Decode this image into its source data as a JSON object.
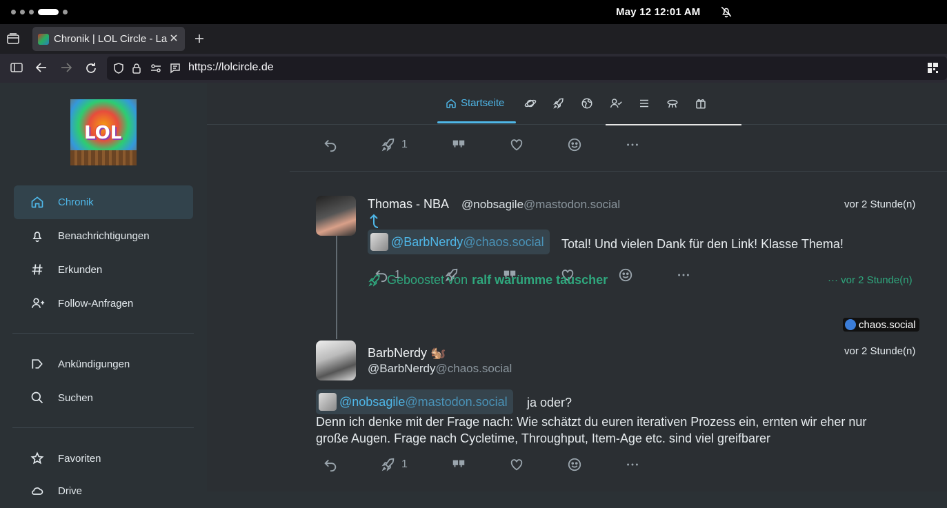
{
  "os": {
    "clock": "May 12  12:01 AM"
  },
  "browser": {
    "tab_title": "Chronik | LOL Circle - La",
    "url": "https://lolcircle.de"
  },
  "sidebar": {
    "logo_text": "LOL",
    "items": [
      {
        "label": "Chronik",
        "icon": "home-icon",
        "active": true
      },
      {
        "label": "Benachrichtigungen",
        "icon": "bell-icon"
      },
      {
        "label": "Erkunden",
        "icon": "hash-icon"
      },
      {
        "label": "Follow-Anfragen",
        "icon": "user-plus-icon"
      },
      {
        "label": "Ankündigungen",
        "icon": "megaphone-icon"
      },
      {
        "label": "Suchen",
        "icon": "search-icon"
      },
      {
        "label": "Favoriten",
        "icon": "star-icon"
      },
      {
        "label": "Drive",
        "icon": "cloud-icon"
      }
    ]
  },
  "topnav": {
    "home_label": "Startseite",
    "icons": [
      "planet-icon",
      "rocket-icon",
      "globe-icon",
      "user-check-icon",
      "list-icon",
      "antenna-icon",
      "gift-icon"
    ]
  },
  "timeline": {
    "first_actions": {
      "boost_count": "1"
    },
    "post1": {
      "name": "Thomas - NBA",
      "handle": "@nobsagile",
      "handle_domain": "@mastodon.social",
      "time": "vor 2 Stunde(n)",
      "mention_user": "@BarbNerdy",
      "mention_domain": "@chaos.social",
      "text": "Total! Und vielen Dank für den Link! Klasse Thema!",
      "reply_count": "1"
    },
    "boost": {
      "prefix": "Geboostet von",
      "by": "ralf warümme tauscher",
      "time": "vor 2 Stunde(n)",
      "more": "···"
    },
    "post2": {
      "name": "BarbNerdy",
      "name_emoji": "🐿️",
      "handle": "@BarbNerdy",
      "handle_domain": "@chaos.social",
      "time": "vor 2 Stunde(n)",
      "instance": "chaos.social",
      "mention_user": "@nobsagile",
      "mention_domain": "@mastodon.social",
      "after_mention": "ja oder?",
      "line1": "Denn ich denke mit der Frage nach: Wie schätzt du euren iterativen Prozess ein, ernten wir eher nur",
      "line2": "große Augen. Frage nach Cycletime, Throughput, Item-Age etc. sind viel greifbarer",
      "boost_count": "1"
    }
  },
  "colors": {
    "accent": "#4fb7e8",
    "boost": "#2fa77d",
    "sidebar_bg": "#2b3135",
    "main_bg": "#2b2f33"
  }
}
